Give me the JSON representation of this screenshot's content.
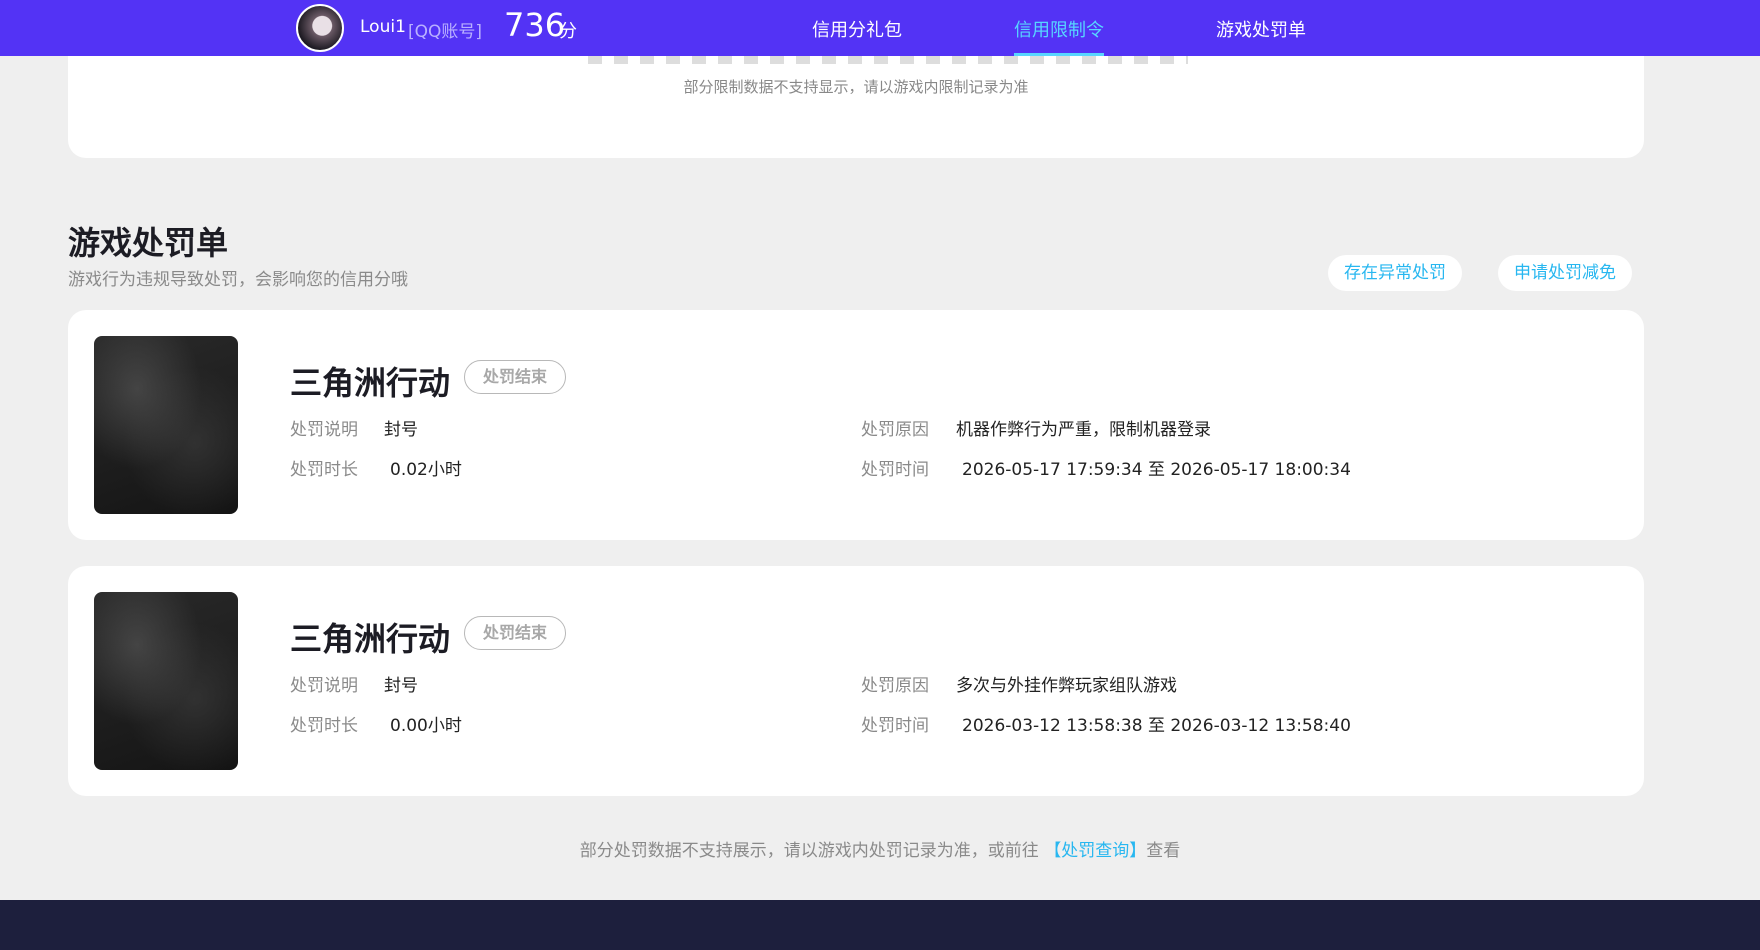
{
  "header": {
    "username": "Loui1",
    "account_tag": "[QQ账号]",
    "score": "736",
    "score_unit": "分",
    "nav": [
      "信用分礼包",
      "信用限制令",
      "游戏处罚单"
    ],
    "active_nav_index": 1
  },
  "restriction_card": {
    "note": "部分限制数据不支持显示，请以游戏内限制记录为准"
  },
  "penalty_section": {
    "title": "游戏处罚单",
    "subtitle": "游戏行为违规导致处罚，会影响您的信用分哦",
    "actions": [
      "存在异常处罚",
      "申请处罚减免"
    ]
  },
  "penalties": [
    {
      "game": "三角洲行动",
      "status": "处罚结束",
      "desc_label": "处罚说明",
      "desc": "封号",
      "duration_label": "处罚时长",
      "duration": "0.02小时",
      "reason_label": "处罚原因",
      "reason": "机器作弊行为严重，限制机器登录",
      "time_label": "处罚时间",
      "time": "2026-05-17 17:59:34 至 2026-05-17 18:00:34"
    },
    {
      "game": "三角洲行动",
      "status": "处罚结束",
      "desc_label": "处罚说明",
      "desc": "封号",
      "duration_label": "处罚时长",
      "duration": "0.00小时",
      "reason_label": "处罚原因",
      "reason": "多次与外挂作弊玩家组队游戏",
      "time_label": "处罚时间",
      "time": "2026-03-12 13:58:38 至 2026-03-12 13:58:40"
    }
  ],
  "footer": {
    "note_prefix": "部分处罚数据不支持展示，请以游戏内处罚记录为准，或前往",
    "link": "【处罚查询】",
    "note_suffix": "查看"
  },
  "colors": {
    "topbar": "#5333f5",
    "accent": "#28b7f0",
    "active_nav": "#57d5ff",
    "footer_bar": "#1d1f3d",
    "page_bg": "#efefef"
  }
}
